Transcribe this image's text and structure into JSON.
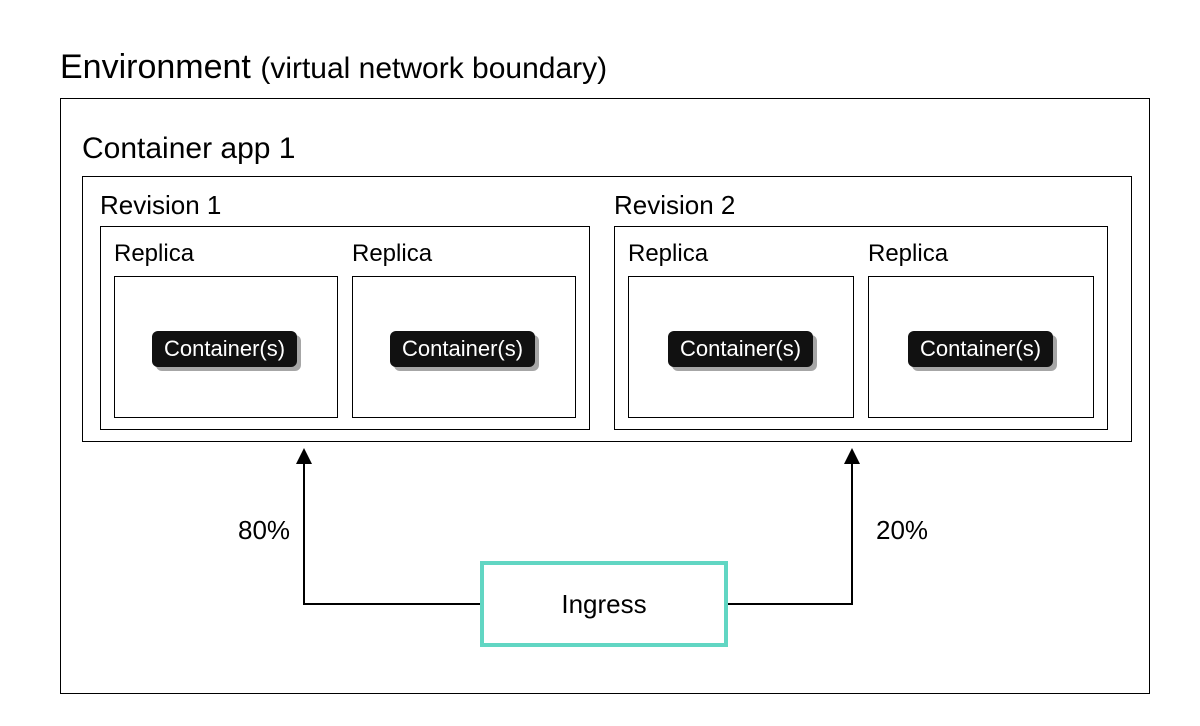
{
  "environment": {
    "title_main": "Environment",
    "title_sub": "(virtual network boundary)"
  },
  "container_app": {
    "title": "Container app 1",
    "revisions": [
      {
        "title": "Revision 1",
        "traffic_pct": "80%",
        "replicas": [
          {
            "label": "Replica",
            "container_label": "Container(s)"
          },
          {
            "label": "Replica",
            "container_label": "Container(s)"
          }
        ]
      },
      {
        "title": "Revision 2",
        "traffic_pct": "20%",
        "replicas": [
          {
            "label": "Replica",
            "container_label": "Container(s)"
          },
          {
            "label": "Replica",
            "container_label": "Container(s)"
          }
        ]
      }
    ]
  },
  "ingress": {
    "label": "Ingress"
  }
}
